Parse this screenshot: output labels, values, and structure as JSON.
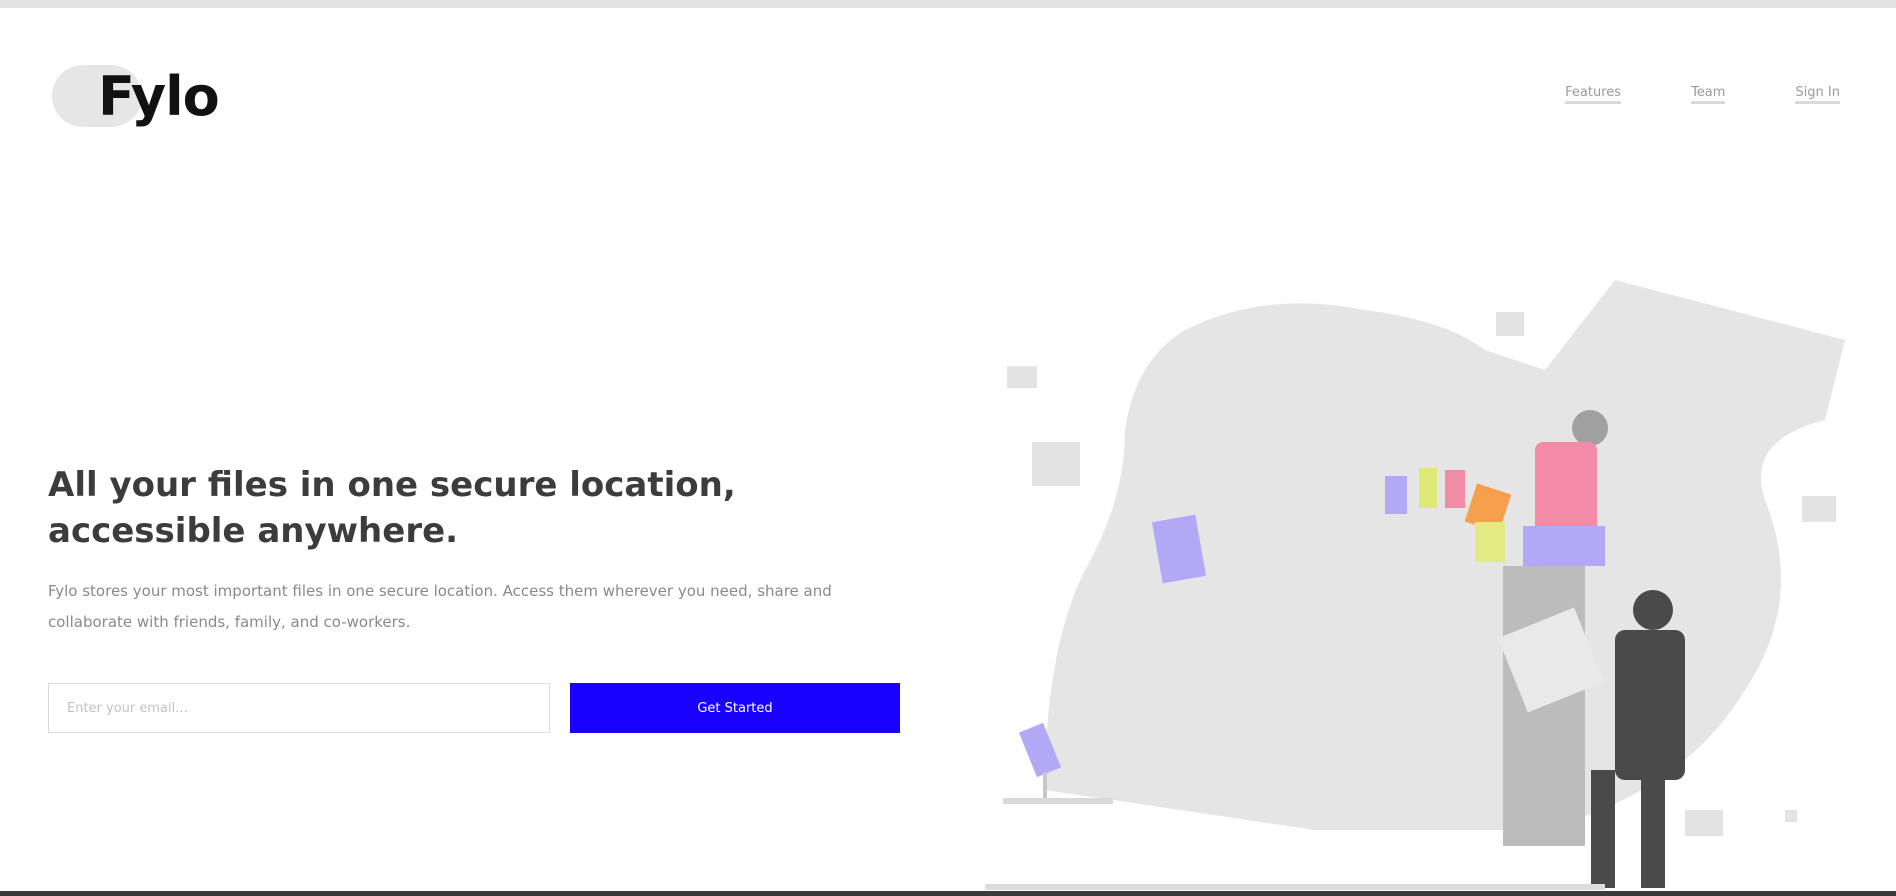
{
  "brand": {
    "name": "Fylo",
    "logo_icon": "cloud-logo-icon"
  },
  "nav": {
    "items": [
      {
        "label": "Features"
      },
      {
        "label": "Team"
      },
      {
        "label": "Sign In"
      }
    ]
  },
  "hero": {
    "title": "All your files in one secure location, accessible anywhere.",
    "description": "Fylo stores your most important files in one secure location. Access them wherever you need, share and collaborate with friends, family, and co-workers."
  },
  "signup": {
    "email_placeholder": "Enter your email...",
    "button_label": "Get Started"
  },
  "colors": {
    "accent": "#1a00ff",
    "illustration_bg": "#e5e5e5",
    "pink": "#f28ba8",
    "lavender": "#b3a8f5",
    "orange": "#f6a04d",
    "lime": "#e2ea82",
    "dark_figure": "#4a4a4a"
  },
  "illustration": {
    "name": "hero-illustration"
  }
}
